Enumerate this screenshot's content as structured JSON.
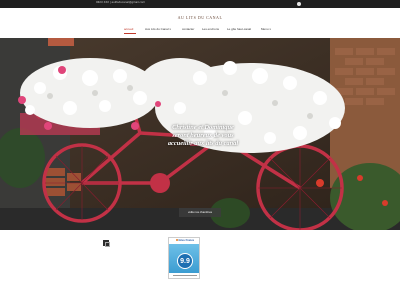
{
  "topbar": {
    "contact_text": "06XX XXX | aulitsducanal@gmail.com"
  },
  "header": {
    "site_title": "AU LITS DU CANAL"
  },
  "nav": {
    "items": [
      {
        "label": "accueil",
        "active": true,
        "dropdown": false
      },
      {
        "label": "Aux Lits du Canal",
        "active": false,
        "dropdown": true
      },
      {
        "label": "contacter",
        "active": false,
        "dropdown": false
      },
      {
        "label": "Les environs",
        "active": false,
        "dropdown": false
      },
      {
        "label": "Le gîte haut-canal",
        "active": false,
        "dropdown": false
      },
      {
        "label": "Menu",
        "active": false,
        "dropdown": true
      }
    ]
  },
  "hero": {
    "headline": "Christine et Dominique seront heureux de vous accueillir aux lits du canal",
    "button_label": "voilà nos chambres"
  },
  "badge": {
    "brand": "Gites France",
    "score": "9.9"
  },
  "colors": {
    "accent": "#c0392b",
    "topbar": "#1f1f1f",
    "title": "#6a4a3a"
  }
}
